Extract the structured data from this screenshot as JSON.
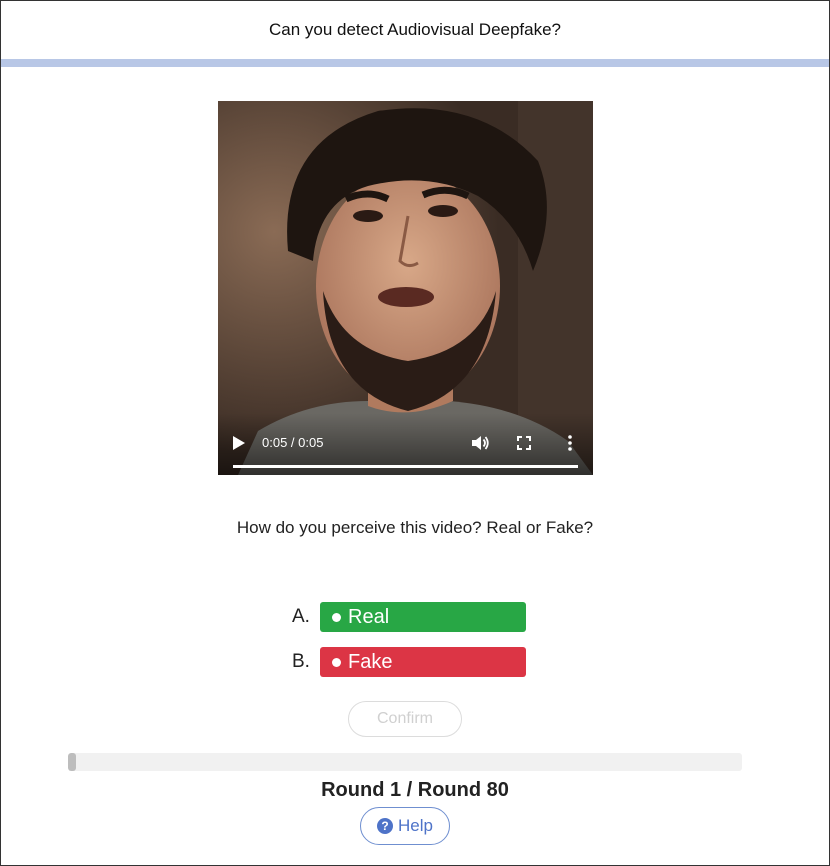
{
  "header": {
    "title": "Can you detect Audiovisual Deepfake?"
  },
  "video": {
    "time_display": "0:05 / 0:05",
    "icons": {
      "play": "play-icon",
      "volume": "volume-icon",
      "fullscreen": "fullscreen-icon",
      "more": "more-vertical-icon"
    },
    "progress": 1.0
  },
  "question": {
    "text": "How do you perceive this video? Real or Fake?"
  },
  "options": [
    {
      "letter": "A.",
      "label": "Real",
      "color": "#28a745"
    },
    {
      "letter": "B.",
      "label": "Fake",
      "color": "#dc3545"
    }
  ],
  "confirm": {
    "label": "Confirm"
  },
  "progress": {
    "current_round": 1,
    "total_rounds": 80,
    "fraction": 0.0125
  },
  "round_text": "Round 1 / Round 80",
  "help": {
    "label": "Help",
    "icon": "question-circle-icon"
  },
  "colors": {
    "header_bar": "#b8c7e6",
    "help_accent": "#4e73c8"
  }
}
